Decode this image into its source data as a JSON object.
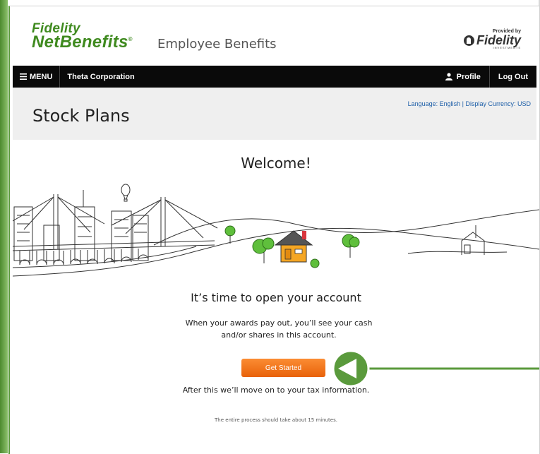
{
  "header": {
    "logo_line1": "Fidelity",
    "logo_line2": "NetBenefits",
    "logo_mark": "®",
    "section": "Employee Benefits",
    "provided_by": "Provided by",
    "provider_name": "Fidelity",
    "provider_sub": "INVESTMENTS"
  },
  "nav": {
    "menu_label": "MENU",
    "menu_icon": "hamburger-icon",
    "company": "Theta Corporation",
    "profile_label": "Profile",
    "profile_icon": "person-icon",
    "logout_label": "Log Out"
  },
  "page": {
    "title": "Stock Plans",
    "language_currency": "Language: English | Display Currency: USD"
  },
  "main": {
    "welcome": "Welcome!",
    "subtitle": "It’s time to open your account",
    "description": "When your awards pay out, you’ll see your cash and/or shares in this account.",
    "cta_label": "Get Started",
    "after_text": "After this we’ll move on to your tax information.",
    "time_note": "The entire process should take about 15 minutes."
  },
  "colors": {
    "brand_green": "#3f8a1f",
    "nav_bg": "#0a0a0a",
    "cta_orange": "#f47b20",
    "link_blue": "#1e5fa8",
    "annotation_green": "#5a9a3c"
  }
}
